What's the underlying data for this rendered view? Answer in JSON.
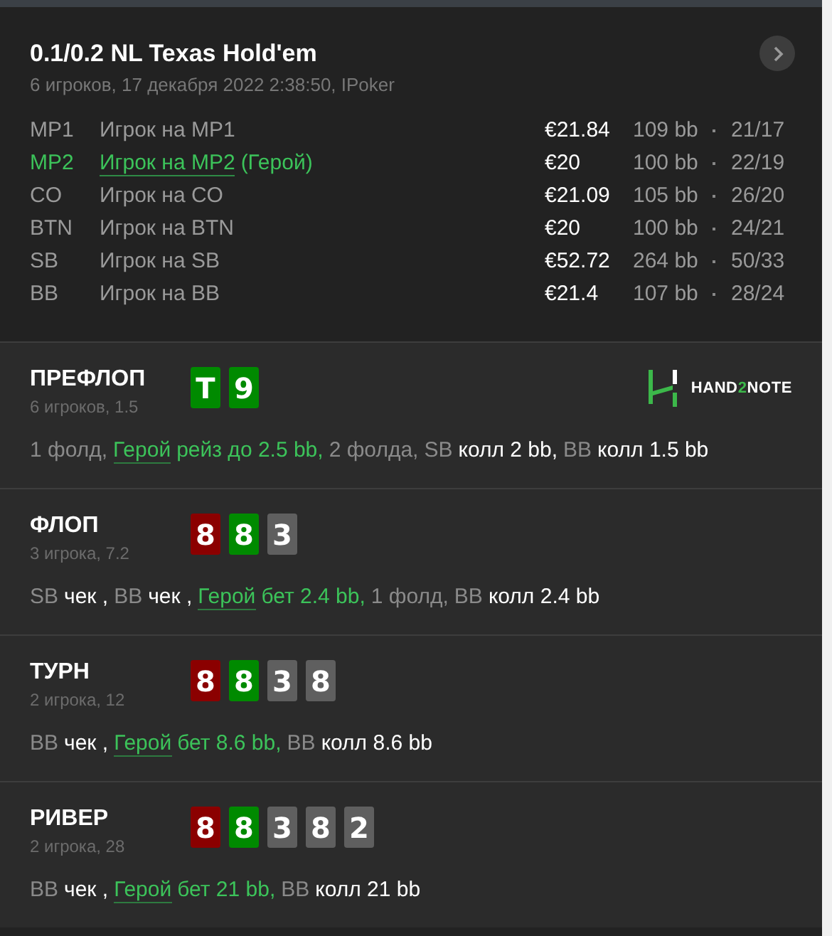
{
  "hand": {
    "title": "0.1/0.2 NL Texas Hold'em",
    "subtitle": "6 игроков, 17 декабря 2022 2:38:50, IPoker"
  },
  "players": [
    {
      "position": "MP1",
      "name": "Игрок на MP1",
      "hero": false,
      "stack": "€21.84",
      "bb": "109 bb",
      "stats": "21/17"
    },
    {
      "position": "MP2",
      "name": "Игрок на MP2",
      "hero": true,
      "hero_tag": "(Герой)",
      "stack": "€20",
      "bb": "100 bb",
      "stats": "22/19"
    },
    {
      "position": "CO",
      "name": "Игрок на CO",
      "hero": false,
      "stack": "€21.09",
      "bb": "105 bb",
      "stats": "26/20"
    },
    {
      "position": "BTN",
      "name": "Игрок на BTN",
      "hero": false,
      "stack": "€20",
      "bb": "100 bb",
      "stats": "24/21"
    },
    {
      "position": "SB",
      "name": "Игрок на SB",
      "hero": false,
      "stack": "€52.72",
      "bb": "264 bb",
      "stats": "50/33"
    },
    {
      "position": "BB",
      "name": "Игрок на BB",
      "hero": false,
      "stack": "€21.4",
      "bb": "107 bb",
      "stats": "28/24"
    }
  ],
  "logo": {
    "parts": [
      {
        "text": "HAND",
        "accent": false
      },
      {
        "text": "2",
        "accent": true
      },
      {
        "text": "NOTE",
        "accent": false
      }
    ]
  },
  "streets": [
    {
      "name": "ПРЕФЛОП",
      "info": "6 игроков, 1.5",
      "cards": [
        {
          "rank": "T",
          "color": "#008a00"
        },
        {
          "rank": "9",
          "color": "#008a00"
        }
      ],
      "actions": [
        {
          "kind": "plain",
          "text": "1 фолд,"
        },
        {
          "kind": "hero",
          "text": "Герой"
        },
        {
          "kind": "hero_action",
          "text": "рейз до 2.5 bb,"
        },
        {
          "kind": "plain",
          "text": "2 фолда,"
        },
        {
          "kind": "position",
          "text": "SB"
        },
        {
          "kind": "action",
          "text": "колл 2 bb,"
        },
        {
          "kind": "position",
          "text": "BB"
        },
        {
          "kind": "action",
          "text": "колл 1.5 bb"
        }
      ]
    },
    {
      "name": "ФЛОП",
      "info": "3 игрока, 7.2",
      "cards": [
        {
          "rank": "8",
          "color": "#8b0000"
        },
        {
          "rank": "8",
          "color": "#008a00"
        },
        {
          "rank": "3",
          "color": "#5f5f5f"
        }
      ],
      "actions": [
        {
          "kind": "position",
          "text": "SB"
        },
        {
          "kind": "action",
          "text": "чек ,"
        },
        {
          "kind": "position",
          "text": "BB"
        },
        {
          "kind": "action",
          "text": "чек ,"
        },
        {
          "kind": "hero",
          "text": "Герой"
        },
        {
          "kind": "hero_action",
          "text": "бет 2.4 bb,"
        },
        {
          "kind": "plain",
          "text": "1 фолд,"
        },
        {
          "kind": "position",
          "text": "BB"
        },
        {
          "kind": "action",
          "text": "колл 2.4 bb"
        }
      ]
    },
    {
      "name": "ТУРН",
      "info": "2 игрока, 12",
      "cards": [
        {
          "rank": "8",
          "color": "#8b0000"
        },
        {
          "rank": "8",
          "color": "#008a00"
        },
        {
          "rank": "3",
          "color": "#5f5f5f"
        },
        {
          "rank": "8",
          "color": "#5f5f5f"
        }
      ],
      "actions": [
        {
          "kind": "position",
          "text": "BB"
        },
        {
          "kind": "action",
          "text": "чек ,"
        },
        {
          "kind": "hero",
          "text": "Герой"
        },
        {
          "kind": "hero_action",
          "text": "бет 8.6 bb,"
        },
        {
          "kind": "position",
          "text": "BB"
        },
        {
          "kind": "action",
          "text": "колл 8.6 bb"
        }
      ]
    },
    {
      "name": "РИВЕР",
      "info": "2 игрока, 28",
      "cards": [
        {
          "rank": "8",
          "color": "#8b0000"
        },
        {
          "rank": "8",
          "color": "#008a00"
        },
        {
          "rank": "3",
          "color": "#5f5f5f"
        },
        {
          "rank": "8",
          "color": "#5f5f5f"
        },
        {
          "rank": "2",
          "color": "#5f5f5f"
        }
      ],
      "actions": [
        {
          "kind": "position",
          "text": "BB"
        },
        {
          "kind": "action",
          "text": "чек ,"
        },
        {
          "kind": "hero",
          "text": "Герой"
        },
        {
          "kind": "hero_action",
          "text": "бет 21 bb,"
        },
        {
          "kind": "position",
          "text": "BB"
        },
        {
          "kind": "action",
          "text": "колл 21 bb"
        }
      ]
    }
  ]
}
